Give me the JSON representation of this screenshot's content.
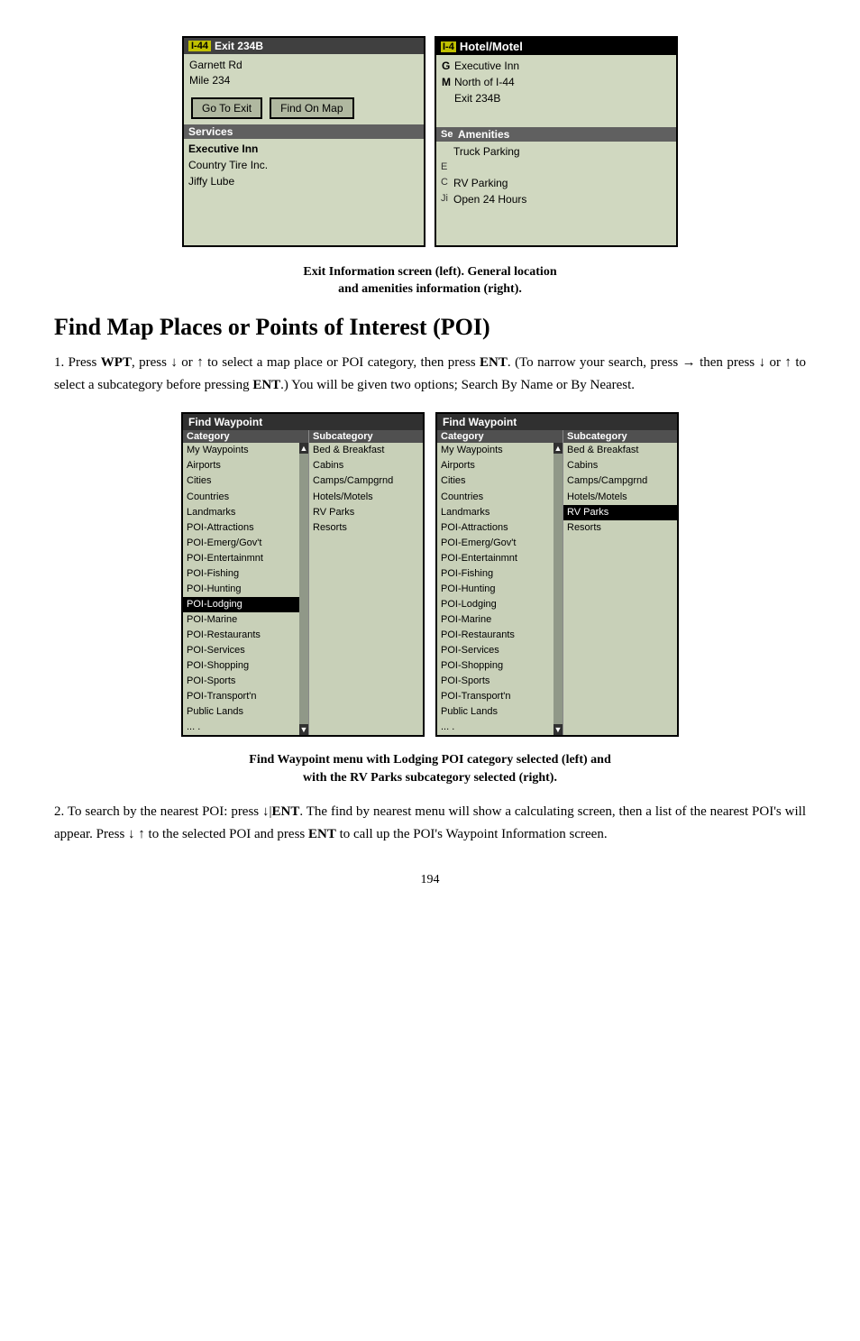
{
  "screens": {
    "left": {
      "header": {
        "marker": "I-44",
        "title": "Exit 234B"
      },
      "lines": [
        "Garnett Rd",
        "Mile 234"
      ],
      "buttons": [
        "Go To Exit",
        "Find On Map"
      ],
      "services_header": "Services",
      "services_list": [
        "Executive Inn",
        "Country Tire Inc.",
        "Jiffy Lube"
      ]
    },
    "right": {
      "header": {
        "marker": "I-4",
        "title": "Hotel/Motel"
      },
      "lines": [
        {
          "letter": "G",
          "text": "Executive Inn"
        },
        {
          "letter": "M",
          "text": "North of I-44"
        },
        {
          "letter": "",
          "text": "Exit 234B"
        }
      ],
      "amenities_header": "Amenities",
      "amenities": [
        {
          "letter": "Se",
          "text": "Truck Parking"
        },
        {
          "letter": "E",
          "text": ""
        },
        {
          "letter": "C",
          "text": "RV Parking"
        },
        {
          "letter": "Ji",
          "text": "Open 24 Hours"
        }
      ]
    }
  },
  "caption1": {
    "line1": "Exit Information screen (left). General location",
    "line2": "and amenities information (right)."
  },
  "section_heading": "Find Map Places or Points of Interest (POI)",
  "para1": {
    "text": "1. Press WPT, press ↓ or ↑ to select a map place or POI category, then press ENT. (To narrow your search, press → then press ↓ or ↑ to select a subcategory before pressing ENT.) You will be given two options; Search By Name or By Nearest."
  },
  "waypoint_screens": {
    "left": {
      "header": "Find Waypoint",
      "col1_header": "Category",
      "col2_header": "Subcategory",
      "categories": [
        "My Waypoints",
        "Airports",
        "Cities",
        "Countries",
        "Landmarks",
        "POI-Attractions",
        "POI-Emerg/Gov't",
        "POI-Entertainmnt",
        "POI-Fishing",
        "POI-Hunting",
        "POI-Lodging",
        "POI-Marine",
        "POI-Restaurants",
        "POI-Services",
        "POI-Shopping",
        "POI-Sports",
        "POI-Transport'n",
        "Public Lands",
        "... ."
      ],
      "subcategories": [
        "Bed & Breakfast",
        "Cabins",
        "Camps/Campgrnd",
        "Hotels/Motels",
        "RV Parks",
        "Resorts"
      ],
      "selected_category": "POI-Lodging"
    },
    "right": {
      "header": "Find Waypoint",
      "col1_header": "Category",
      "col2_header": "Subcategory",
      "categories": [
        "My Waypoints",
        "Airports",
        "Cities",
        "Countries",
        "Landmarks",
        "POI-Attractions",
        "POI-Emerg/Gov't",
        "POI-Entertainmnt",
        "POI-Fishing",
        "POI-Hunting",
        "POI-Lodging",
        "POI-Marine",
        "POI-Restaurants",
        "POI-Services",
        "POI-Shopping",
        "POI-Sports",
        "POI-Transport'n",
        "Public Lands",
        "... ."
      ],
      "subcategories": [
        "Bed & Breakfast",
        "Cabins",
        "Camps/Campgrnd",
        "Hotels/Motels",
        "RV Parks",
        "Resorts"
      ],
      "selected_subcategory": "RV Parks"
    }
  },
  "caption2": {
    "line1": "Find Waypoint menu with Lodging POI category selected (left) and",
    "line2": "with the RV Parks subcategory selected (right)."
  },
  "para2": {
    "text": "2. To search by the nearest POI: press ↓|ENT. The find by nearest menu will show a calculating screen, then a list of the nearest POI's will appear. Press ↓ ↑ to the selected POI and press ENT to call up the POI's Waypoint Information screen."
  },
  "page_number": "194"
}
